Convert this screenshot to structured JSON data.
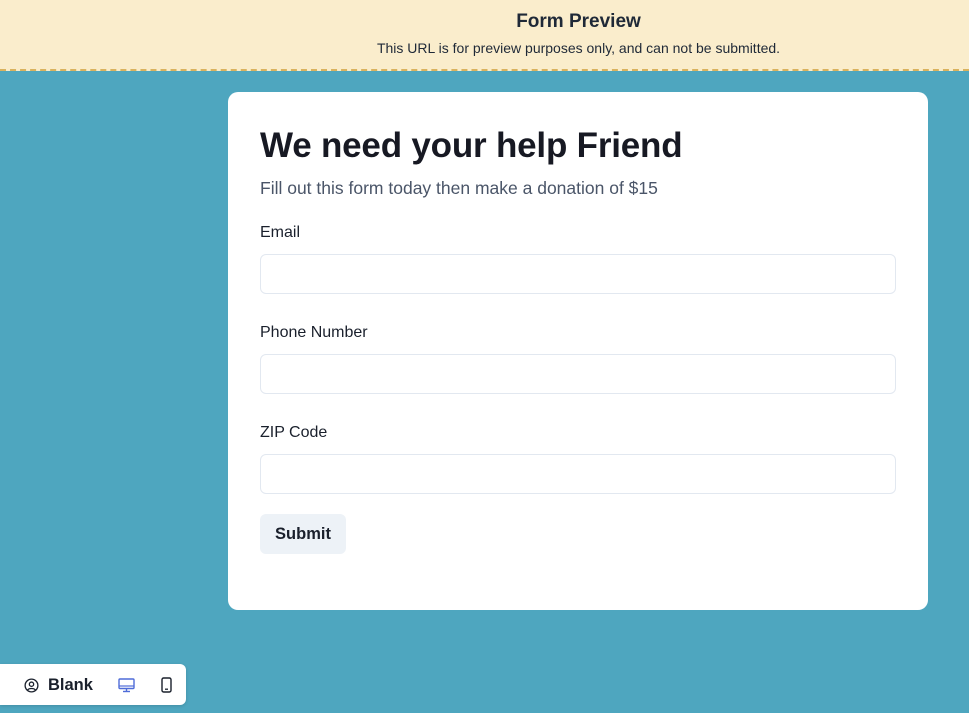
{
  "banner": {
    "title": "Form Preview",
    "subtitle": "This URL is for preview purposes only, and can not be submitted."
  },
  "form": {
    "title": "We need your help Friend",
    "subtitle": "Fill out this form today then make a donation of $15",
    "fields": [
      {
        "label": "Email",
        "value": "",
        "placeholder": ""
      },
      {
        "label": "Phone Number",
        "value": "",
        "placeholder": ""
      },
      {
        "label": "ZIP Code",
        "value": "",
        "placeholder": ""
      }
    ],
    "submit_label": "Submit"
  },
  "toolbar": {
    "account_icon": "user-circle-icon",
    "account_label": "Blank",
    "desktop_icon": "desktop-icon",
    "mobile_icon": "mobile-icon",
    "active_view": "desktop",
    "active_color": "#4f6cd8"
  },
  "colors": {
    "background": "#4ea6bf",
    "banner": "#faedcc",
    "banner_border": "#d9b25e",
    "card": "#ffffff"
  }
}
